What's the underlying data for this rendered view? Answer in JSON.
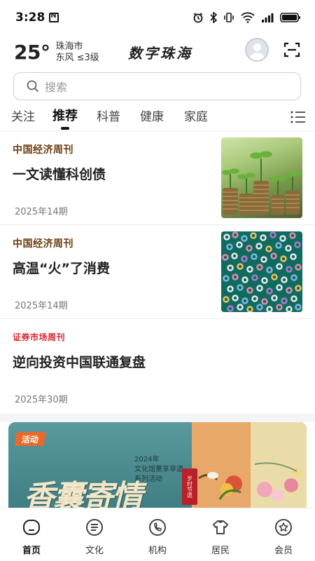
{
  "status_bar": {
    "time": "3:28"
  },
  "header": {
    "temperature": "25°",
    "city": "珠海市",
    "wind": "东风  ≤3级",
    "app_title": "数字珠海"
  },
  "search": {
    "placeholder": "搜索"
  },
  "tabs": [
    {
      "label": "关注",
      "active": false
    },
    {
      "label": "推荐",
      "active": true
    },
    {
      "label": "科普",
      "active": false
    },
    {
      "label": "健康",
      "active": false
    },
    {
      "label": "家庭",
      "active": false
    }
  ],
  "articles": [
    {
      "source": "中国经济周刊",
      "headline": "一文读懂科创债",
      "issue": "2025年14期",
      "image": "seedlings-on-coins"
    },
    {
      "source": "中国经济周刊",
      "headline": "高温“火”了消费",
      "issue": "2025年14期",
      "image": "colorful-beads"
    },
    {
      "source": "证券市场周刊",
      "headline": "逆向投资中国联通复盘",
      "issue": "2025年30期",
      "image": ""
    }
  ],
  "banner": {
    "tag": "活动",
    "year": "2024年",
    "subtitle_1": "文化馆董享非遗",
    "subtitle_2": "系列活动",
    "title": "香囊寄情",
    "seal": "岁时节遗"
  },
  "bottom_nav": [
    {
      "label": "首页",
      "icon": "home-icon",
      "active": true
    },
    {
      "label": "文化",
      "icon": "culture-icon",
      "active": false
    },
    {
      "label": "机构",
      "icon": "institution-icon",
      "active": false
    },
    {
      "label": "居民",
      "icon": "resident-icon",
      "active": false
    },
    {
      "label": "会员",
      "icon": "member-icon",
      "active": false
    }
  ],
  "colors": {
    "source_brown": "#6b3d10",
    "source_red": "#d8262e",
    "activity_orange": "#e76a2a"
  }
}
